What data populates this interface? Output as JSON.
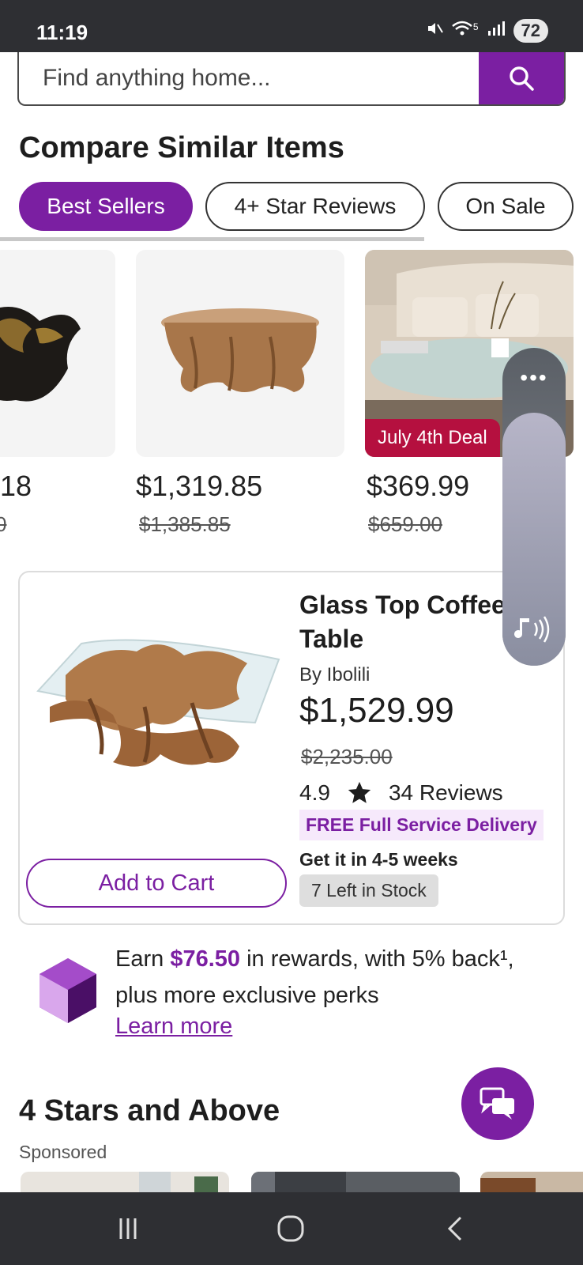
{
  "status_bar": {
    "time": "11:19",
    "battery": "72",
    "signal_text": "5"
  },
  "search": {
    "placeholder": "Find anything home..."
  },
  "compare": {
    "title": "Compare Similar Items",
    "filters": [
      {
        "label": "Best Sellers",
        "active": true
      },
      {
        "label": "4+ Star Reviews",
        "active": false
      },
      {
        "label": "On Sale",
        "active": false
      }
    ]
  },
  "carousel": {
    "items": [
      {
        "price": "18",
        "old_price": "0"
      },
      {
        "price": "$1,319.85",
        "old_price": "$1,385.85"
      },
      {
        "price": "$369.99",
        "old_price": "$659.00",
        "badge": "July 4th Deal"
      }
    ]
  },
  "side_panel": {
    "menu_icon": "ellipsis-icon",
    "audio_icon": "sound-icon"
  },
  "featured": {
    "title": "Glass Top Coffee Table",
    "brand": "By Ibolili",
    "price": "$1,529.99",
    "old_price": "$2,235.00",
    "rating": "4.9",
    "reviews": "34 Reviews",
    "delivery": "FREE Full Service Delivery",
    "eta": "Get it in 4-5 weeks",
    "stock": "7 Left in Stock",
    "add_to_cart": "Add to Cart"
  },
  "rewards": {
    "prefix": "Earn ",
    "amount": "$76.50",
    "suffix": " in rewards, with 5% back¹, plus more exclusive perks",
    "learn_more": "Learn more"
  },
  "section2": {
    "title": "4 Stars and Above",
    "sponsored": "Sponsored"
  },
  "colors": {
    "accent": "#7b1fa2",
    "deal": "#b5103f",
    "system_bar": "#2e2f33"
  }
}
